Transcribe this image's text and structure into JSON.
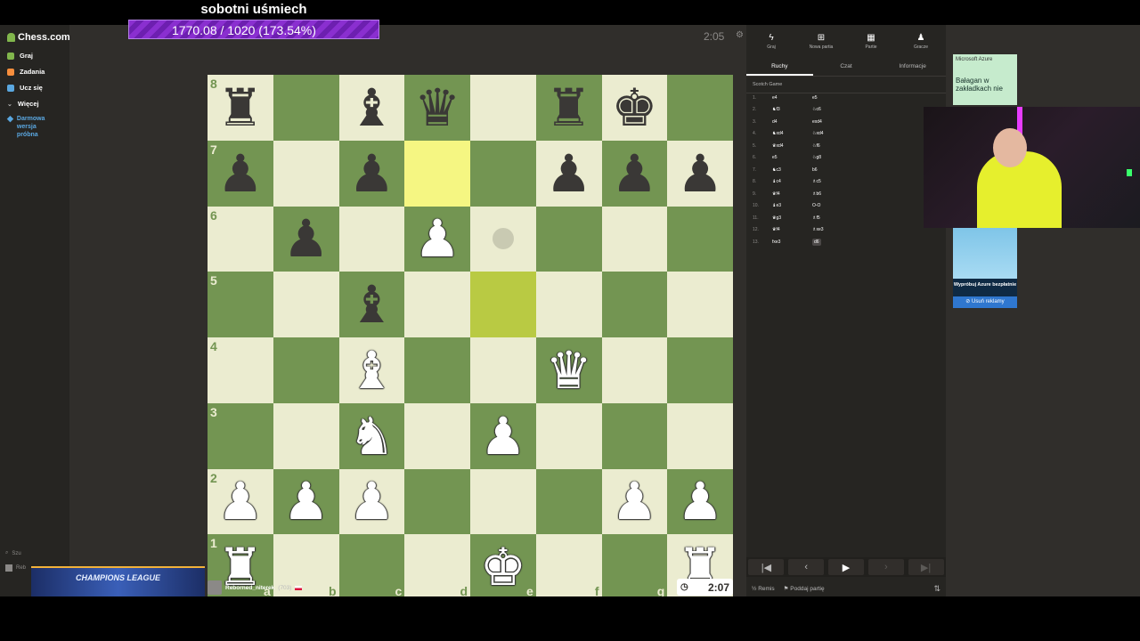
{
  "overlay": {
    "title": "sobotni uśmiech",
    "progress": "1770.08 / 1020 (173.54%)"
  },
  "sidebar": {
    "logo": "Chess.com",
    "items": [
      {
        "label": "Graj",
        "color": "#81b64c"
      },
      {
        "label": "Zadania",
        "color": "#f78e3d"
      },
      {
        "label": "Ucz się",
        "color": "#5aa7e0"
      },
      {
        "label": "Więcej",
        "color": "#bababa"
      }
    ],
    "trial": "Darmowa wersja próbna",
    "bottom": [
      "Szu",
      "Reb"
    ]
  },
  "game": {
    "top_clock": "2:05",
    "bottom_player": "Reborned_niterek",
    "bottom_rating": "(703)",
    "bottom_clock": "2:07",
    "ranks": [
      "8",
      "7",
      "6",
      "5",
      "4",
      "3",
      "2",
      "1"
    ],
    "files": [
      "a",
      "b",
      "c",
      "d",
      "e",
      "f",
      "g",
      "h"
    ],
    "board": [
      [
        "br",
        "",
        "bb",
        "bq",
        "",
        "br",
        "bk",
        ""
      ],
      [
        "bp",
        "",
        "bp",
        "",
        "",
        "bp",
        "bp",
        "bp"
      ],
      [
        "",
        "bp",
        "",
        "wp",
        "",
        "",
        "",
        ""
      ],
      [
        "",
        "",
        "bb",
        "",
        "",
        "",
        "",
        ""
      ],
      [
        "",
        "",
        "wb",
        "",
        "",
        "wq",
        "",
        ""
      ],
      [
        "",
        "",
        "wn",
        "",
        "wp",
        "",
        "",
        ""
      ],
      [
        "wp",
        "wp",
        "wp",
        "",
        "",
        "",
        "wp",
        "wp"
      ],
      [
        "wr",
        "",
        "",
        "",
        "wk",
        "",
        "",
        "wr"
      ]
    ],
    "highlights": [
      "d7",
      "e5"
    ],
    "hints": [
      "e6"
    ]
  },
  "panel": {
    "top_tabs": [
      {
        "label": "Graj",
        "icon": "bolt-icon"
      },
      {
        "label": "Nowa partia",
        "icon": "plus-icon"
      },
      {
        "label": "Partie",
        "icon": "grid-icon"
      },
      {
        "label": "Gracze",
        "icon": "players-icon"
      }
    ],
    "sub_tabs": [
      "Ruchy",
      "Czat",
      "Informacje"
    ],
    "opening": "Scotch Game",
    "moves": [
      {
        "n": "1.",
        "w": "e4",
        "b": "e5"
      },
      {
        "n": "2.",
        "w": "♞f3",
        "b": "♘c6"
      },
      {
        "n": "3.",
        "w": "d4",
        "b": "exd4"
      },
      {
        "n": "4.",
        "w": "♞xd4",
        "b": "♘xd4"
      },
      {
        "n": "5.",
        "w": "♛xd4",
        "b": "♘f6"
      },
      {
        "n": "6.",
        "w": "e5",
        "b": "♘g8"
      },
      {
        "n": "7.",
        "w": "♞c3",
        "b": "b6"
      },
      {
        "n": "8.",
        "w": "♝c4",
        "b": "♗c5"
      },
      {
        "n": "9.",
        "w": "♛f4",
        "b": "♗b6"
      },
      {
        "n": "10.",
        "w": "♝e3",
        "b": "O-O"
      },
      {
        "n": "11.",
        "w": "♛g3",
        "b": "♗f5"
      },
      {
        "n": "12.",
        "w": "♛f4",
        "b": "♗xe3"
      },
      {
        "n": "13.",
        "w": "fxe3",
        "b": "d6"
      }
    ],
    "draw_label": "Remis",
    "resign_label": "Poddaj partię"
  },
  "ad": {
    "brand": "Microsoft Azure",
    "headline": "Bałagan w zakładkach nie",
    "cta_text": "Wypróbuj Azure bezpłatnie",
    "remove_ads": "Usuń reklamy"
  },
  "stream": {
    "champions": "CHAMPIONS LEAGUE"
  }
}
